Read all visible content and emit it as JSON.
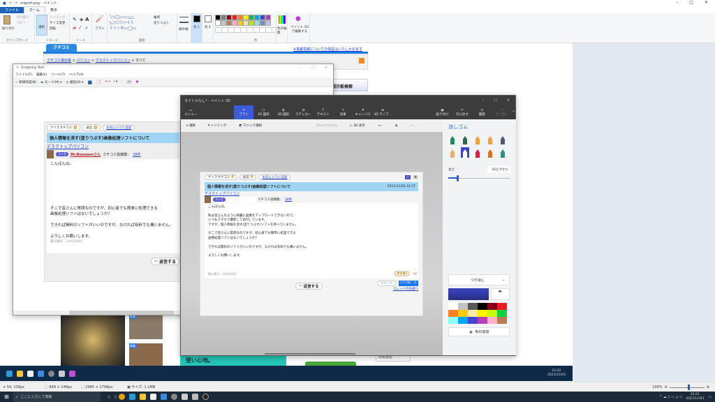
{
  "paint": {
    "title": "snipmf.png - ペイント",
    "tabs": [
      "ファイル",
      "ホーム",
      "表示"
    ],
    "clipboard": {
      "paste": "貼り付け",
      "cut": "切り取り",
      "copy": "コピー",
      "label": "クリップボード"
    },
    "image": {
      "select": "選択",
      "crop": "トリミング",
      "resize": "サイズ変更",
      "rotate": "回転",
      "label": "イメージ"
    },
    "tools_label": "ツール",
    "brush": "ブラシ",
    "shapes": {
      "outline": "輪郭",
      "fill": "塗りつぶし",
      "label": "図形"
    },
    "size": "線の幅",
    "color1": "色 1",
    "color2": "色 2",
    "edit_colors": "色の編集",
    "paint3d": "ペイント 3D で編集する",
    "colors_label": "色",
    "palette": [
      "#000000",
      "#7f7f7f",
      "#880015",
      "#ed1c24",
      "#ff7f27",
      "#fff200",
      "#22b14c",
      "#00a2e8",
      "#3f48cc",
      "#a349a4",
      "#ffffff",
      "#c3c3c3",
      "#b97a57",
      "#ffaec9",
      "#ffc90e",
      "#efe4b0",
      "#b5e61d",
      "#99d9ea",
      "#7092be",
      "#c8bfe7"
    ],
    "status": {
      "cursor": "54, 239px",
      "selection": "649 × 148px",
      "image_size": "2965 × 1798px",
      "file_size": "サイズ: 1.1MB",
      "zoom": "100%",
      "zoom_fraction": 0.55
    }
  },
  "website": {
    "tab": "クチコミ",
    "notice": "※掲載情報についての保証はいたしかねます",
    "breadcrumb": [
      "クチコミ掲示板",
      "パソコン",
      "デスクトップパソコン",
      "すべて"
    ],
    "search_box": "掲示板検索",
    "nice_label": "ナイスクチコミ",
    "nice_count": "0",
    "reply_label": "返信",
    "reply_count": "0",
    "fav": "お気に入りに追加",
    "title": "個人情報を消す(塗りつぶす)画像処理ソフトについて",
    "date": "2021/11/03 22:37",
    "category": "デスクトップパソコン",
    "badge": "スレ主",
    "user": "Mr.Booooonさん",
    "posts_label": "クチコミ投稿数：",
    "posts": "28件",
    "body": [
      "こんばんは。",
      "",
      "私は皆さんのように綺麗に画像をアップロードできないので、",
      "いつもスマホで撮影して添付しています。",
      "ですが、個人情報を消す(塗りつぶす)ソフトを持っていません。",
      "",
      "そこで皆さんに質問なのですが、初心者でも簡単に処理できる",
      "画像処理ソフトはないでしょうか？",
      "",
      "できれば無料のソフトがいいのですが、なければ有料でも構いません。",
      "",
      "よろしくお願いします。"
    ],
    "post_no": "書込番号：24428304",
    "nice_btn": "ナイス!",
    "nice_zero": "0点",
    "reply_btn": "返信する",
    "tweet": "ツイート",
    "like": "いいね！ 0",
    "thread_top": "スレッドの先頭へ",
    "font_small": "小",
    "font_large": "大",
    "ad_text": "使い心地。",
    "history": "閲覧履歴",
    "new_badge": "新着",
    "inner_time": "22:42",
    "inner_date": "2021/11/03"
  },
  "snipping": {
    "title": "Snipping Tool",
    "menu": [
      "ファイル(F)",
      "編集(E)",
      "ツール(T)",
      "ヘルプ(H)"
    ],
    "new": "新規作成(N)",
    "mode": "モード(M)",
    "delay": "遅延(D)"
  },
  "paint3d": {
    "title": "タイトルなし* - ペイント 3D",
    "menu": "メニュー",
    "tools": [
      "ブラシ",
      "2D 図形",
      "3D 図形",
      "ステッカー",
      "テキスト",
      "効果",
      "キャンバス",
      "3D ライブ..."
    ],
    "right_tools": [
      "貼り付け",
      "元に戻す",
      "履歴",
      "やり直し"
    ],
    "sub": {
      "select": "選択",
      "crop": "トリミング",
      "magic": "マジック選択",
      "mr": "Mixed Reality",
      "view3d": "3D 表示"
    },
    "panel": {
      "title": "消しゴム",
      "size_label": "太さ",
      "size_value": "25ピクセル",
      "size_fraction": 0.15,
      "finish": "つや消し",
      "add_color": "色の追加",
      "current_color": "#3b46c4",
      "colors": [
        "#ffffff",
        "#c3c3c3",
        "#585858",
        "#000000",
        "#880015",
        "#ed1c24",
        "#ff7f27",
        "#ffc90e",
        "#fdeca6",
        "#fff200",
        "#c4ff0e",
        "#0ed145",
        "#8cfffb",
        "#00a8f3",
        "#3f48cc",
        "#b83dba",
        "#ffaec8",
        "#b97a56"
      ],
      "brushes": [
        "#1e8a6a",
        "#2f6b4f",
        "#f0a040",
        "#f0a040",
        "#555a70",
        "#e8b070",
        "#3f48cc",
        "#d0204a",
        "#e07020",
        "#2f8f80"
      ]
    }
  },
  "taskbar": {
    "search": "ここに入力して検索",
    "time": "23:51",
    "date": "2021/11/03"
  }
}
